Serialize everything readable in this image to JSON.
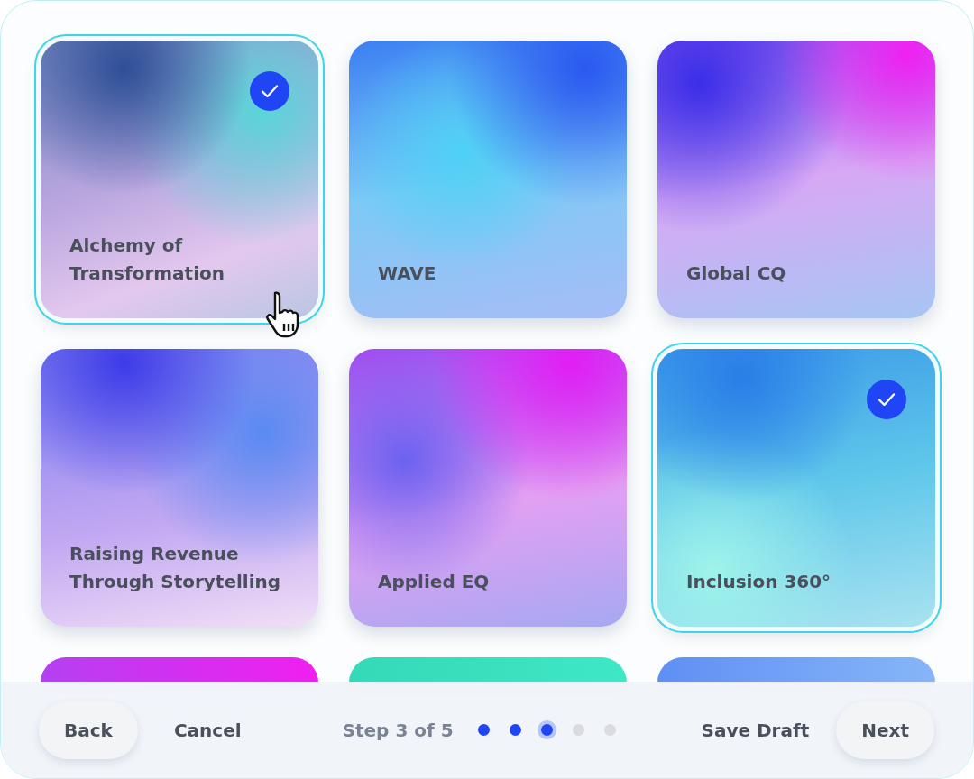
{
  "cards": [
    {
      "title": "Alchemy of Transformation",
      "selected": true
    },
    {
      "title": "WAVE",
      "selected": false
    },
    {
      "title": "Global CQ",
      "selected": false
    },
    {
      "title": "Raising Revenue Through Storytelling",
      "selected": false
    },
    {
      "title": "Applied EQ",
      "selected": false
    },
    {
      "title": "Inclusion 360°",
      "selected": true
    },
    {
      "kind": "partial"
    },
    {
      "kind": "partial"
    },
    {
      "kind": "partial"
    }
  ],
  "footer": {
    "back": "Back",
    "cancel": "Cancel",
    "step_label": "Step 3 of 5",
    "steps": [
      {
        "completed": true,
        "selected": false
      },
      {
        "completed": true,
        "selected": false
      },
      {
        "completed": false,
        "selected": true
      },
      {
        "completed": false,
        "selected": false
      },
      {
        "completed": false,
        "selected": false
      }
    ],
    "save": "Save Draft",
    "next": "Next"
  }
}
